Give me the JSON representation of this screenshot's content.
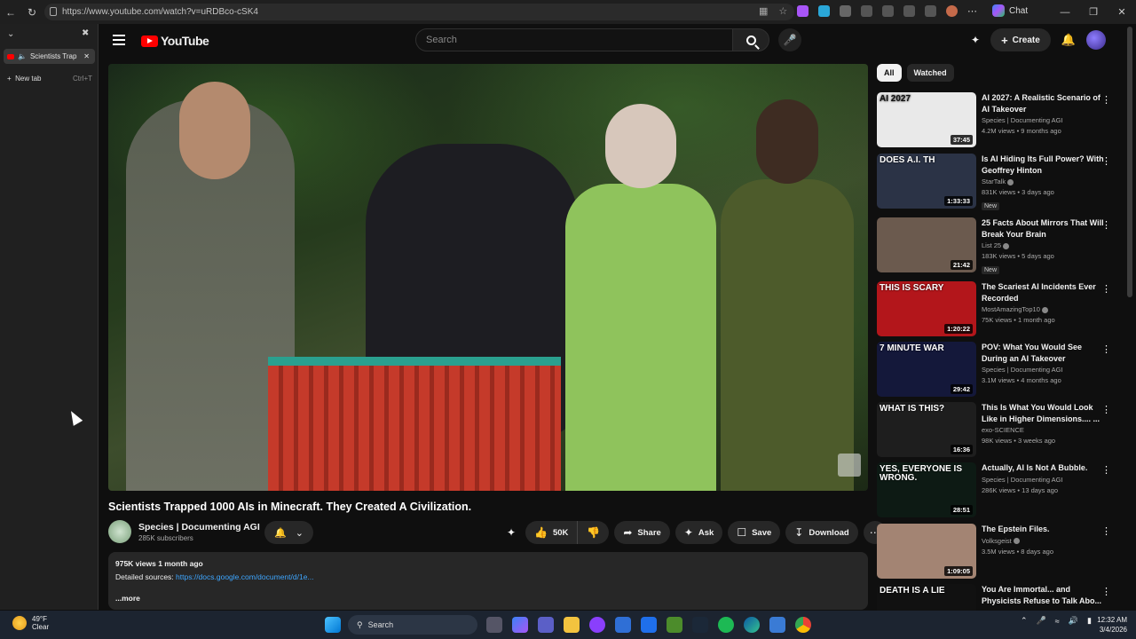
{
  "browser": {
    "url": "https://www.youtube.com/watch?v=uRDBco-cSK4",
    "chat_label": "Chat",
    "tabs": [
      {
        "label": "Scientists Trap"
      }
    ],
    "new_tab": {
      "label": "New tab",
      "shortcut": "Ctrl+T"
    }
  },
  "header": {
    "logo_text": "YouTube",
    "search_placeholder": "Search",
    "create_label": "Create"
  },
  "video": {
    "title": "Scientists Trapped 1000 AIs in Minecraft. They Created A Civilization.",
    "channel": "Species | Documenting AGI",
    "subscribers": "285K subscribers",
    "likes": "50K",
    "share_label": "Share",
    "ask_label": "Ask",
    "save_label": "Save",
    "download_label": "Download",
    "stats": "975K views  1 month ago",
    "sources_label": "Detailed sources: ",
    "sources_link": "https://docs.google.com/document/d/1e...",
    "more_label": "...more"
  },
  "chips": [
    "All",
    "Watched"
  ],
  "recommendations": [
    {
      "title": "AI 2027: A Realistic Scenario of AI Takeover",
      "channel": "Species | Documenting AGI",
      "meta": "4.2M views • 9 months ago",
      "duration": "37:45",
      "overlay": "AI 2027",
      "thumb_color": "#e9e9e9",
      "verified": false,
      "new": false
    },
    {
      "title": "Is AI Hiding Its Full Power? With Geoffrey Hinton",
      "channel": "StarTalk",
      "meta": "831K views • 3 days ago",
      "duration": "1:33:33",
      "overlay": "DOES A.I. TH",
      "thumb_color": "#2b3346",
      "verified": true,
      "new": true,
      "new_label": "New"
    },
    {
      "title": "25 Facts About Mirrors That Will Break Your Brain",
      "channel": "List 25",
      "meta": "183K views • 5 days ago",
      "duration": "21:42",
      "overlay": "",
      "thumb_color": "#6b5a4e",
      "verified": true,
      "new": true,
      "new_label": "New"
    },
    {
      "title": "The Scariest AI Incidents Ever Recorded",
      "channel": "MostAmazingTop10",
      "meta": "75K views • 1 month ago",
      "duration": "1:20:22",
      "overlay": "THIS IS SCARY",
      "thumb_color": "#b3161b",
      "verified": true,
      "new": false
    },
    {
      "title": "POV: What You Would See During an AI Takeover",
      "channel": "Species | Documenting AGI",
      "meta": "3.1M views • 4 months ago",
      "duration": "29:42",
      "overlay": "7 MINUTE WAR",
      "thumb_color": "#14183a",
      "verified": false,
      "new": false
    },
    {
      "title": "This Is What You Would Look Like in Higher Dimensions.... ...",
      "channel": "exo-SCIENCE",
      "meta": "98K views • 3 weeks ago",
      "duration": "16:36",
      "overlay": "WHAT IS THIS?",
      "thumb_color": "#1e1e1e",
      "verified": false,
      "new": false
    },
    {
      "title": "Actually, AI Is Not A Bubble.",
      "channel": "Species | Documenting AGI",
      "meta": "286K views • 13 days ago",
      "duration": "28:51",
      "overlay": "YES, EVERYONE IS WRONG.",
      "thumb_color": "#0d1a14",
      "verified": false,
      "new": false
    },
    {
      "title": "The Epstein Files.",
      "channel": "Volksgeist",
      "meta": "3.5M views • 8 days ago",
      "duration": "1:09:05",
      "overlay": "",
      "thumb_color": "#a38473",
      "verified": true,
      "new": false
    },
    {
      "title": "You Are Immortal... and Physicists Refuse to Talk Abo...",
      "channel": "",
      "meta": "",
      "duration": "",
      "overlay": "DEATH IS A LIE",
      "thumb_color": "#111111",
      "verified": false,
      "new": false
    }
  ],
  "taskbar": {
    "temp": "49°F",
    "condition": "Clear",
    "search_label": "Search",
    "time": "12:32 AM",
    "date": "3/4/2026"
  }
}
